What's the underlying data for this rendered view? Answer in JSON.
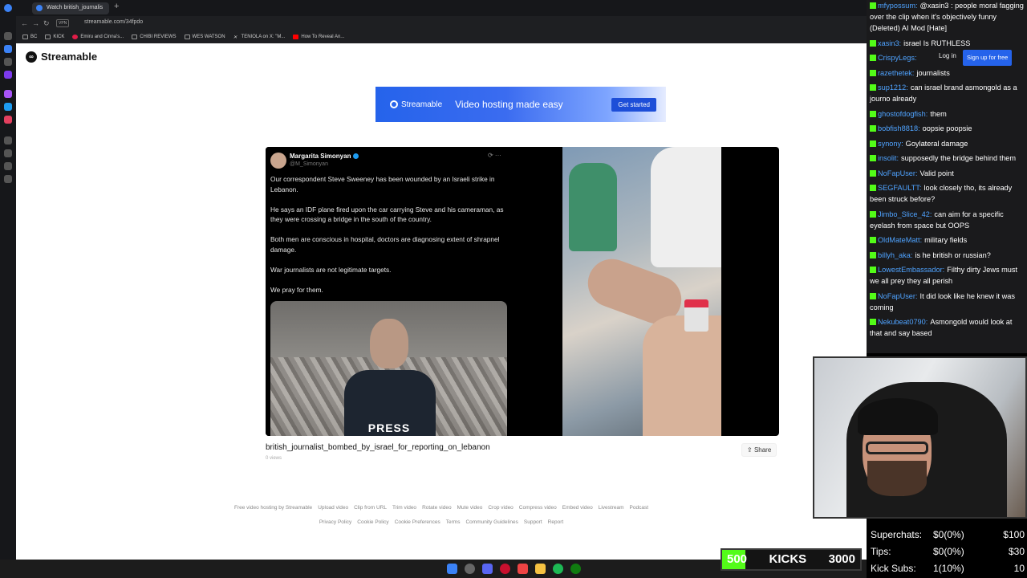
{
  "browser": {
    "tab_title": "Watch british_journalis",
    "url": "streamable.com/34fpdo",
    "vpn_label": "VPN",
    "bookmarks": [
      "BC",
      "KICK",
      "Emiru and Cinna's...",
      "CHIBI REVIEWS",
      "WES WATSON",
      "TENIOLA on X: \"M...",
      "How To Reveal An..."
    ]
  },
  "page": {
    "logo": "Streamable",
    "ad": {
      "brand": "Streamable",
      "tagline": "Video hosting made easy",
      "cta": "Get started"
    },
    "tweet": {
      "name": "Margarita Simonyan",
      "handle": "@M_Simonyan",
      "paragraphs": [
        "Our correspondent Steve Sweeney has been wounded by an Israeli strike in Lebanon.",
        "He says an IDF plane fired upon the car carrying Steve and his cameraman, as they were crossing a bridge in the south of the country.",
        "Both men are conscious in hospital, doctors are diagnosing extent of shrapnel damage.",
        "War journalists are not legitimate targets.",
        "We pray for them."
      ],
      "press_label": "PRESS"
    },
    "video_title": "british_journalist_bombed_by_israel_for_reporting_on_lebanon",
    "views": "0 views",
    "share_label": "Share",
    "footer_links_1": [
      "Free video hosting by Streamable",
      "Upload video",
      "Clip from URL",
      "Trim video",
      "Rotate video",
      "Mute video",
      "Crop video",
      "Compress video",
      "Embed video",
      "Livestream",
      "Podcast"
    ],
    "footer_links_2": [
      "Privacy Policy",
      "Cookie Policy",
      "Cookie Preferences",
      "Terms",
      "Community Guidelines",
      "Support",
      "Report"
    ]
  },
  "chat": {
    "login": "Log in",
    "signup": "Sign up for free",
    "messages": [
      {
        "user": "mfypossum",
        "text": "@xasin3 : people moral fagging over the clip when it's objectively funny (Deleted) AI Mod [Hate]"
      },
      {
        "user": "xasin3",
        "text": "israel Is RUTHLESS"
      },
      {
        "user": "CrispyLegs",
        "text": ""
      },
      {
        "user": "razethetek",
        "text": "journalists"
      },
      {
        "user": "sup1212",
        "text": "can israel brand asmongold as a journo already"
      },
      {
        "user": "ghostofdogfish",
        "text": "them"
      },
      {
        "user": "bobfish8818",
        "text": "oopsie poopsie"
      },
      {
        "user": "synony",
        "text": "Goylateral damage"
      },
      {
        "user": "insolit",
        "text": "supposedly the bridge behind them"
      },
      {
        "user": "NoFapUser",
        "text": "Valid point"
      },
      {
        "user": "SEGFAULTT",
        "text": "look closely tho, its already been struck before?"
      },
      {
        "user": "Jimbo_Slice_42",
        "text": "can aim for a specific eyelash from space but OOPS"
      },
      {
        "user": "OldMateMatt",
        "text": "military fields"
      },
      {
        "user": "billyh_aka",
        "text": "is he british or russian?"
      },
      {
        "user": "LowestEmbassador",
        "text": "Filthy dirty Jews must we all prey they all perish"
      },
      {
        "user": "NoFapUser",
        "text": "It did look like he knew it was coming"
      },
      {
        "user": "Nekubeat0790",
        "text": "Asmongold would look at that and say based"
      }
    ]
  },
  "stats": [
    {
      "label": "Superchats:",
      "value": "$0(0%)",
      "goal": "$100"
    },
    {
      "label": "Tips:",
      "value": "$0(0%)",
      "goal": "$30"
    },
    {
      "label": "Kick Subs:",
      "value": "1(10%)",
      "goal": "10"
    }
  ],
  "kicks_goal": {
    "current": "500",
    "label": "KICKS",
    "target": "3000",
    "progress": 0.17
  },
  "colors": {
    "accent": "#53fc18",
    "streamable_blue": "#2563eb",
    "chat_user": "#4fa3ff"
  }
}
